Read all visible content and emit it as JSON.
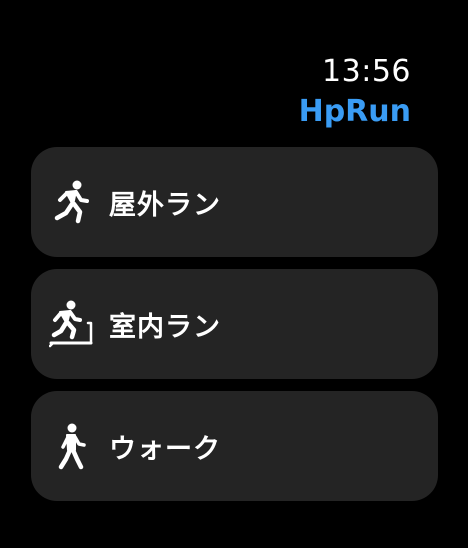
{
  "status": {
    "time": "13:56"
  },
  "app": {
    "title": "HpRun",
    "accent_color": "#3a9cf4"
  },
  "menu": {
    "items": [
      {
        "label": "屋外ラン",
        "icon": "outdoor-run-icon"
      },
      {
        "label": "室内ラン",
        "icon": "treadmill-run-icon"
      },
      {
        "label": "ウォーク",
        "icon": "walk-icon"
      }
    ]
  }
}
